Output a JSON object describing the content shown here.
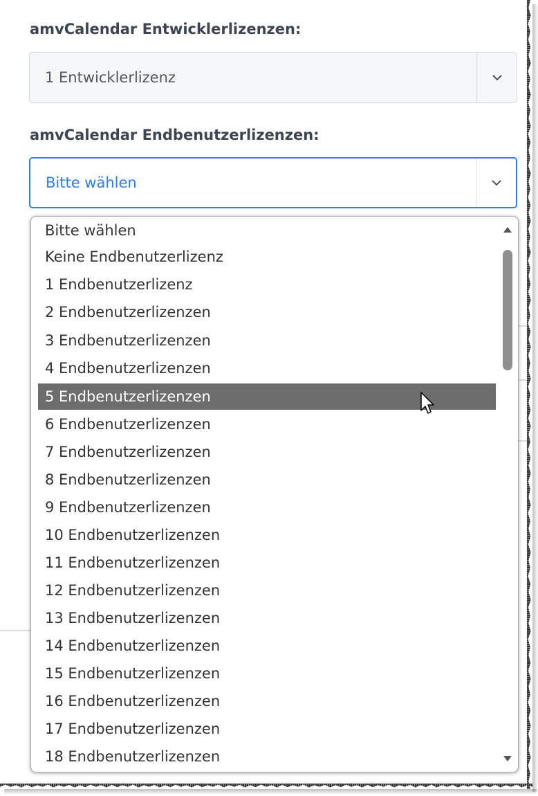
{
  "fields": [
    {
      "label": "amvCalendar Entwicklerlizenzen:",
      "value": "1 Entwicklerlizenz"
    },
    {
      "label": "amvCalendar Endbenutzerlizenzen:",
      "value": "Bitte wählen"
    }
  ],
  "dropdown": {
    "options": [
      "Bitte wählen",
      "Keine Endbenutzerlizenz",
      "1 Endbenutzerlizenz",
      "2 Endbenutzerlizenzen",
      "3 Endbenutzerlizenzen",
      "4 Endbenutzerlizenzen",
      "5 Endbenutzerlizenzen",
      "6 Endbenutzerlizenzen",
      "7 Endbenutzerlizenzen",
      "8 Endbenutzerlizenzen",
      "9 Endbenutzerlizenzen",
      "10 Endbenutzerlizenzen",
      "11 Endbenutzerlizenzen",
      "12 Endbenutzerlizenzen",
      "13 Endbenutzerlizenzen",
      "14 Endbenutzerlizenzen",
      "15 Endbenutzerlizenzen",
      "16 Endbenutzerlizenzen",
      "17 Endbenutzerlizenzen",
      "18 Endbenutzerlizenzen"
    ],
    "highlighted": "5 Endbenutzerlizenzen"
  },
  "icons": {
    "select_arrow": "chevron-down-icon",
    "scroll_up": "triangle-up-icon",
    "scroll_down": "triangle-down-icon",
    "cursor": "mouse-pointer-icon"
  },
  "colors": {
    "focus_blue": "#2f7ff0",
    "label_text": "#3d4650",
    "highlight_bg": "#6d6d6d",
    "disabled_bg": "#f4f6f8"
  }
}
